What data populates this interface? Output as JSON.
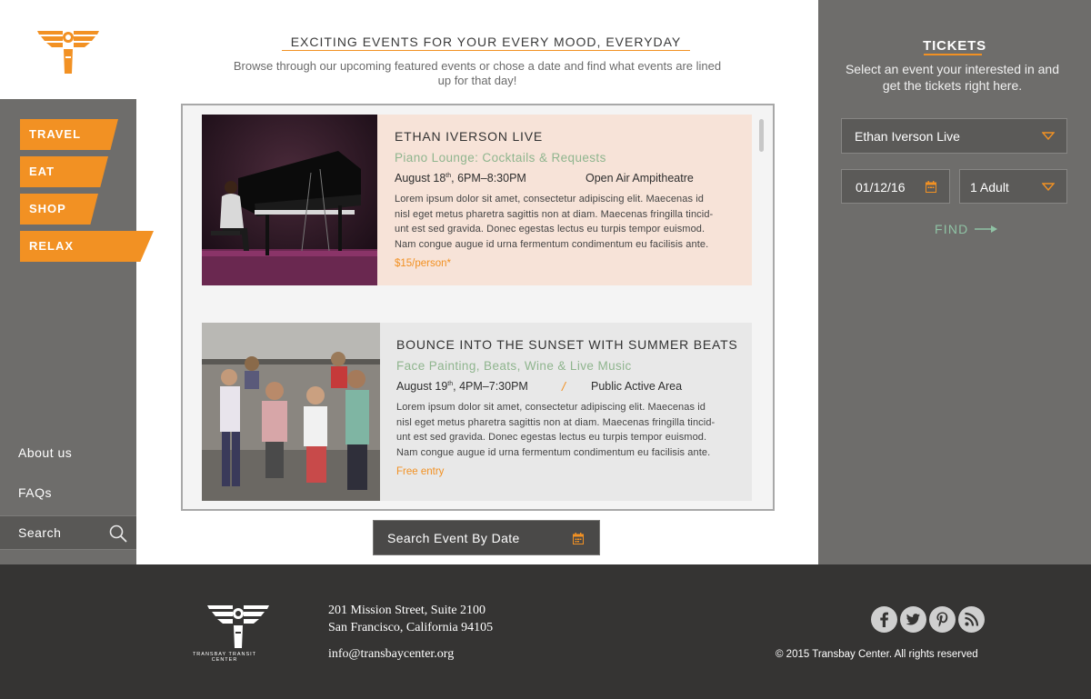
{
  "nav": {
    "items": [
      {
        "label": "TRAVEL"
      },
      {
        "label": "EAT"
      },
      {
        "label": "SHOP"
      },
      {
        "label": "RELAX"
      }
    ],
    "about_label": "About us",
    "faq_label": "FAQs",
    "search_label": "Search"
  },
  "main": {
    "title": "EXCITING EVENTS FOR YOUR EVERY MOOD, EVERYDAY",
    "subtitle_line1": "Browse through our upcoming featured events or chose a date and find what events are lined",
    "subtitle_line2": "up for that day!",
    "date_search_label": "Search Event By Date"
  },
  "events": [
    {
      "title": "ETHAN IVERSON LIVE",
      "subtitle": "Piano Lounge: Cocktails & Requests",
      "date_day": "August 18",
      "date_sup": "th",
      "date_time": ", 6PM–8:30PM",
      "location": "Open Air Ampitheatre",
      "desc_lines": [
        "Lorem ipsum dolor sit amet, consectetur adipiscing elit. Maecenas id",
        "nisl eget metus pharetra sagittis non at diam. Maecenas fringilla tincid-",
        "unt est sed gravida. Donec egestas lectus eu turpis tempor euismod.",
        "Nam congue augue id urna fermentum condimentum eu facilisis ante."
      ],
      "price": "$15/person*"
    },
    {
      "title": "BOUNCE INTO THE SUNSET WITH SUMMER BEATS",
      "subtitle": "Face Painting, Beats, Wine & Live Music",
      "date_day": "August 19",
      "date_sup": "th",
      "date_time": ", 4PM–7:30PM",
      "separator": "/",
      "location": "Public Active Area",
      "desc_lines": [
        "Lorem ipsum dolor sit amet, consectetur adipiscing elit. Maecenas id",
        "nisl eget metus pharetra sagittis non at diam. Maecenas fringilla tincid-",
        "unt est sed gravida. Donec egestas lectus eu turpis tempor euismod.",
        "Nam congue augue id urna fermentum condimentum eu facilisis ante."
      ],
      "price": "Free entry"
    }
  ],
  "tickets": {
    "title": "TICKETS",
    "subtitle_line1": "Select an event your interested in and",
    "subtitle_line2": "get the tickets right here.",
    "event_select": "Ethan Iverson Live",
    "date_value": "01/12/16",
    "party_select": "1 Adult",
    "find_label": "FIND"
  },
  "footer": {
    "logo_text": "TRANSBAY TRANSIT CENTER",
    "address_line1": "201 Mission Street, Suite 2100",
    "address_line2": "San Francisco, California 94105",
    "email": "info@transbaycenter.org",
    "copyright": "© 2015 Transbay Center. All rights reserved"
  },
  "icons": {
    "logo": "transbay-logo-icon",
    "search": "search-icon",
    "calendar": "calendar-icon",
    "dropdown": "chevron-down-icon",
    "arrow": "arrow-right-icon",
    "social": [
      "facebook-icon",
      "twitter-icon",
      "pinterest-icon",
      "rss-icon"
    ]
  },
  "colors": {
    "accent": "#f29123",
    "sidebar": "#6e6d6b",
    "footer": "#353433",
    "event_highlight": "#f7e3d8",
    "green_text": "#8fb58e"
  }
}
